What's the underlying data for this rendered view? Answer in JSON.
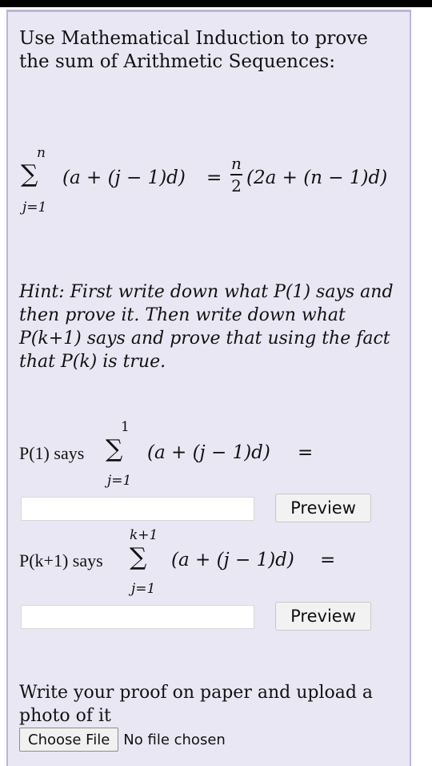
{
  "question": {
    "prompt": "Use Mathematical Induction to prove the sum of Arithmetic Sequences:",
    "equation": {
      "sum_upper": "n",
      "sum_lower": "j=1",
      "summand": "(a + (j − 1)d)",
      "equals": "=",
      "frac_num": "n",
      "frac_den": "2",
      "rhs": "(2a + (n − 1)d)"
    },
    "hint": "Hint: First write down what P(1) says and then prove it. Then write down what P(k+1) says and prove that using the fact that P(k) is true."
  },
  "p1": {
    "label": "P(1) says",
    "sum_upper": "1",
    "sum_lower": "j=1",
    "summand": "(a + (j − 1)d)",
    "equals": "=",
    "input_value": "",
    "preview_label": "Preview"
  },
  "pk1": {
    "label": "P(k+1) says",
    "sum_upper": "k+1",
    "sum_lower": "j=1",
    "summand": "(a + (j − 1)d)",
    "equals": "=",
    "input_value": "",
    "preview_label": "Preview"
  },
  "upload": {
    "instruction": "Write your proof on paper and upload a photo of it",
    "choose_label": "Choose File",
    "status": "No file chosen"
  },
  "colors": {
    "panel_bg": "#e9e7f4",
    "panel_border": "#b9b6d6",
    "top_bar": "#000000"
  }
}
